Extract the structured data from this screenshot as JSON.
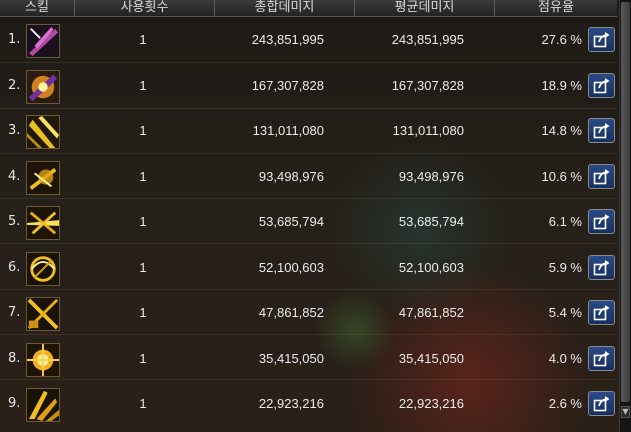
{
  "columns": {
    "skill": "스킬",
    "count": "사용횟수",
    "total": "총합데미지",
    "avg": "평균데미지",
    "share": "점유율"
  },
  "rows": [
    {
      "rank": "1.",
      "count": "1",
      "total": "243,851,995",
      "avg": "243,851,995",
      "share": "27.6 %",
      "icon": "dark-slash-skill-icon"
    },
    {
      "rank": "2.",
      "count": "1",
      "total": "167,307,828",
      "avg": "167,307,828",
      "share": "18.9 %",
      "icon": "purple-burst-skill-icon"
    },
    {
      "rank": "3.",
      "count": "1",
      "total": "131,011,080",
      "avg": "131,011,080",
      "share": "14.8 %",
      "icon": "gold-slash-skill-icon"
    },
    {
      "rank": "4.",
      "count": "1",
      "total": "93,498,976",
      "avg": "93,498,976",
      "share": "10.6 %",
      "icon": "gold-strike-skill-icon"
    },
    {
      "rank": "5.",
      "count": "1",
      "total": "53,685,794",
      "avg": "53,685,794",
      "share": "6.1 %",
      "icon": "gold-burst-skill-icon"
    },
    {
      "rank": "6.",
      "count": "1",
      "total": "52,100,603",
      "avg": "52,100,603",
      "share": "5.9 %",
      "icon": "gold-whirl-skill-icon"
    },
    {
      "rank": "7.",
      "count": "1",
      "total": "47,861,852",
      "avg": "47,861,852",
      "share": "5.4 %",
      "icon": "gold-cross-skill-icon"
    },
    {
      "rank": "8.",
      "count": "1",
      "total": "35,415,050",
      "avg": "35,415,050",
      "share": "4.0 %",
      "icon": "gold-explosion-skill-icon"
    },
    {
      "rank": "9.",
      "count": "1",
      "total": "22,923,216",
      "avg": "22,923,216",
      "share": "2.6 %",
      "icon": "gold-wing-skill-icon"
    }
  ],
  "colors": {
    "header_bg": "#2e2e2e",
    "share_button": "#1f3c74",
    "text": "#ececec"
  }
}
